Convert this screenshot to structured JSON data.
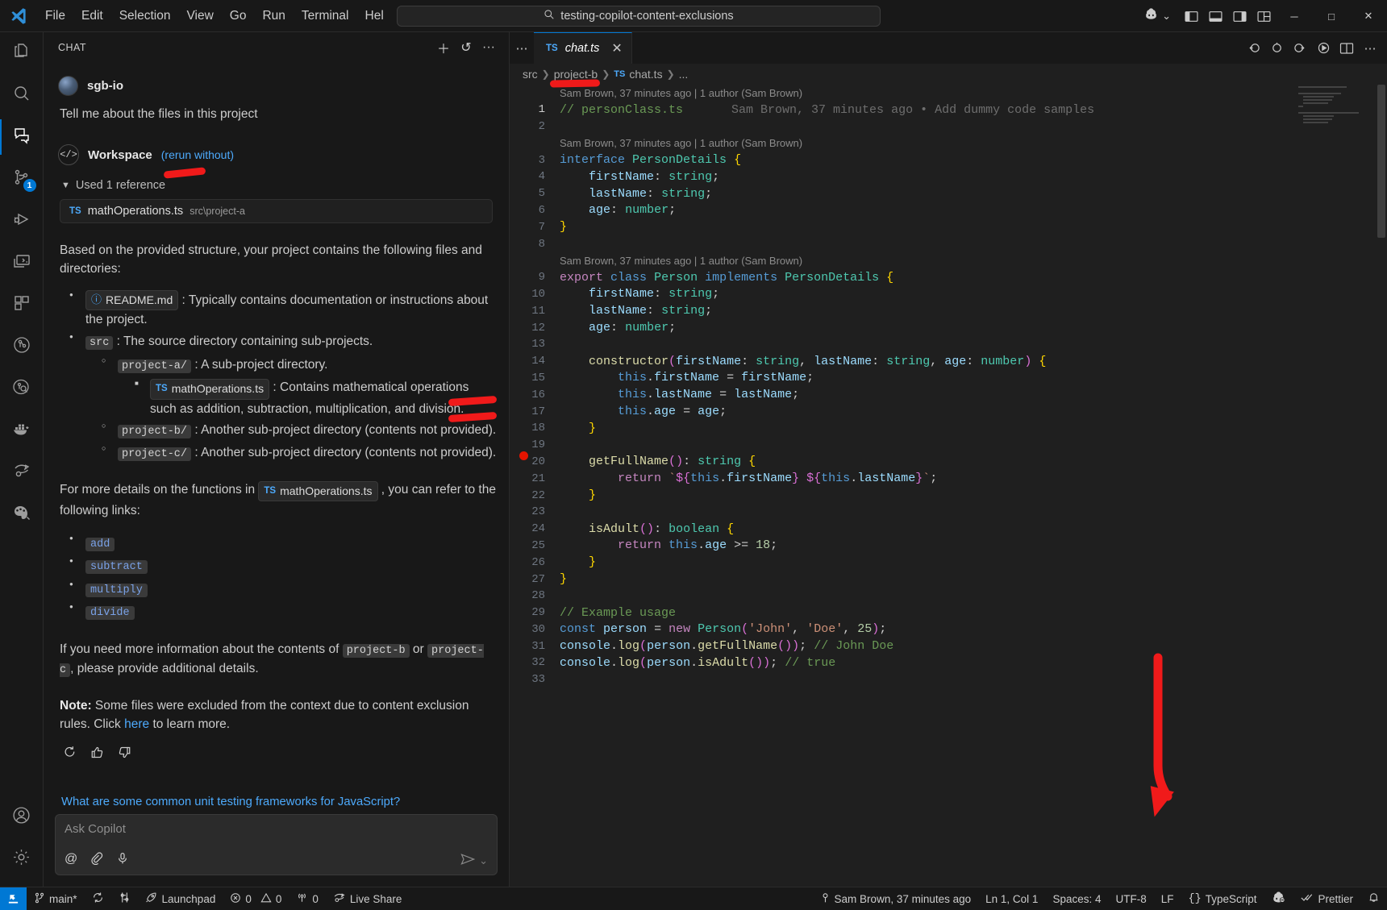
{
  "titlebar": {
    "menus": [
      "File",
      "Edit",
      "Selection",
      "View",
      "Go",
      "Run",
      "Terminal",
      "Hel"
    ],
    "back_icon": "←",
    "forward_icon": "→",
    "search_value": "testing-copilot-content-exclusions",
    "search_icon": "⌕",
    "copilot_icon": "copilot-icon",
    "chevron": "⌄",
    "layout_icons": [
      "panel-left-icon",
      "panel-bottom-icon",
      "panel-right-icon",
      "layout-grid-icon"
    ],
    "minimize": "─",
    "maximize": "□",
    "close": "✕"
  },
  "activitybar": {
    "items": [
      {
        "name": "explorer",
        "icon": "files-icon",
        "badge": ""
      },
      {
        "name": "search",
        "icon": "search-icon",
        "badge": ""
      },
      {
        "name": "chat",
        "icon": "chat-icon",
        "badge": ""
      },
      {
        "name": "source-control",
        "icon": "source-control-icon",
        "badge": "1"
      },
      {
        "name": "run-and-debug",
        "icon": "debug-icon",
        "badge": ""
      },
      {
        "name": "remote-explorer",
        "icon": "remote-icon",
        "badge": ""
      },
      {
        "name": "extensions",
        "icon": "extensions-icon",
        "badge": ""
      },
      {
        "name": "test-explorer",
        "icon": "beaker-icon",
        "badge": ""
      },
      {
        "name": "github-actions",
        "icon": "github-actions-icon",
        "badge": ""
      },
      {
        "name": "docker",
        "icon": "docker-icon",
        "badge": ""
      },
      {
        "name": "live-share",
        "icon": "live-share-icon",
        "badge": ""
      },
      {
        "name": "theme-palette",
        "icon": "palette-icon",
        "badge": ""
      }
    ],
    "bottom": [
      {
        "name": "accounts",
        "icon": "account-icon"
      },
      {
        "name": "settings",
        "icon": "gear-icon"
      }
    ]
  },
  "chat": {
    "title": "CHAT",
    "actions": [
      {
        "name": "new-chat",
        "icon": "＋"
      },
      {
        "name": "chat-history",
        "icon": "↺"
      },
      {
        "name": "more-actions",
        "icon": "···"
      }
    ],
    "user": "sgb-io",
    "user_message": "Tell me about the files in this project",
    "agent": {
      "name": "Workspace",
      "rerun_label": "(rerun without)",
      "icon": "</>"
    },
    "references": {
      "label": "Used 1 reference",
      "items": [
        {
          "type": "TS",
          "file": "mathOperations.ts",
          "path": "src\\project-a"
        }
      ]
    },
    "response": {
      "intro": "Based on the provided structure, your project contains the following files and directories:",
      "tree": [
        {
          "chip": "README.md",
          "chip_icon": "info-icon",
          "chip_style": "ic",
          "text": " : Typically contains documentation or instructions about the project.",
          "children": []
        },
        {
          "chip": "src",
          "chip_style": "mono",
          "text": " : The source directory containing sub-projects.",
          "children": [
            {
              "chip": "project-a/",
              "chip_style": "mono",
              "text": " : A sub-project directory.",
              "children": [
                {
                  "chip": "mathOperations.ts",
                  "chip_icon": "TS",
                  "chip_style": "ic",
                  "text": " : Contains mathematical operations such as addition, subtraction, multiplication, and division."
                }
              ]
            },
            {
              "chip": "project-b/",
              "chip_style": "mono",
              "text": " : Another sub-project directory (contents not provided).",
              "children": []
            },
            {
              "chip": "project-c/",
              "chip_style": "mono",
              "text": " : Another sub-project directory (contents not provided).",
              "children": []
            }
          ]
        }
      ],
      "links_intro_a": "For more details on the functions in ",
      "links_intro_chip": "mathOperations.ts",
      "links_intro_b": " , you can refer to the following links:",
      "functions": [
        "add",
        "subtract",
        "multiply",
        "divide"
      ],
      "closing_a": "If you need more information about the contents of ",
      "closing_chip1": "project-b",
      "closing_mid": " or ",
      "closing_chip2": "project-c",
      "closing_b": ", please provide additional details.",
      "note_label": "Note:",
      "note_text": " Some files were excluded from the context due to content exclusion rules. Click ",
      "note_link": "here",
      "note_tail": " to learn more."
    },
    "feedback": [
      {
        "name": "regenerate",
        "icon": "↻"
      },
      {
        "name": "thumbs-up",
        "icon": "👍"
      },
      {
        "name": "thumbs-down",
        "icon": "👎"
      }
    ],
    "suggestion": "What are some common unit testing frameworks for JavaScript?",
    "input_placeholder": "Ask Copilot",
    "input_icons": [
      {
        "name": "mention",
        "icon": "@"
      },
      {
        "name": "attach",
        "icon": "📎"
      },
      {
        "name": "microphone",
        "icon": "🎙"
      }
    ],
    "send_icon": "➤",
    "send_chevron": "⌄"
  },
  "editor": {
    "tab": {
      "type": "TS",
      "name": "chat.ts",
      "close": "✕"
    },
    "actions": [
      {
        "name": "go-back",
        "icon": "↩"
      },
      {
        "name": "run-tests",
        "icon": "○"
      },
      {
        "name": "go-forward",
        "icon": "↪"
      },
      {
        "name": "run-debug",
        "icon": "▷"
      },
      {
        "name": "split-editor",
        "icon": "◫"
      },
      {
        "name": "more-actions",
        "icon": "···"
      }
    ],
    "breadcrumbs": [
      {
        "label": "src",
        "icon": ""
      },
      {
        "label": "project-b",
        "icon": ""
      },
      {
        "label": "chat.ts",
        "icon": "TS"
      },
      {
        "label": "...",
        "icon": ""
      }
    ],
    "blame_text": "Sam Brown, 37 minutes ago | 1 author (Sam Brown)",
    "inline_blame": "Sam Brown, 37 minutes ago • Add dummy code samples",
    "lines": [
      {
        "n": "1",
        "blame": true,
        "text": "// personClass.ts"
      },
      {
        "n": "2",
        "blame": false,
        "text": ""
      },
      {
        "n": "3",
        "blame": true,
        "text": "interface PersonDetails {"
      },
      {
        "n": "4",
        "blame": false,
        "text": "    firstName: string;"
      },
      {
        "n": "5",
        "blame": false,
        "text": "    lastName: string;"
      },
      {
        "n": "6",
        "blame": false,
        "text": "    age: number;"
      },
      {
        "n": "7",
        "blame": false,
        "text": "}"
      },
      {
        "n": "8",
        "blame": false,
        "text": ""
      },
      {
        "n": "9",
        "blame": true,
        "text": "export class Person implements PersonDetails {"
      },
      {
        "n": "10",
        "blame": false,
        "text": "    firstName: string;"
      },
      {
        "n": "11",
        "blame": false,
        "text": "    lastName: string;"
      },
      {
        "n": "12",
        "blame": false,
        "text": "    age: number;"
      },
      {
        "n": "13",
        "blame": false,
        "text": ""
      },
      {
        "n": "14",
        "blame": false,
        "text": "    constructor(firstName: string, lastName: string, age: number) {"
      },
      {
        "n": "15",
        "blame": false,
        "text": "        this.firstName = firstName;"
      },
      {
        "n": "16",
        "blame": false,
        "text": "        this.lastName = lastName;"
      },
      {
        "n": "17",
        "blame": false,
        "text": "        this.age = age;"
      },
      {
        "n": "18",
        "blame": false,
        "text": "    }"
      },
      {
        "n": "19",
        "blame": false,
        "text": ""
      },
      {
        "n": "20",
        "blame": false,
        "text": "    getFullName(): string {"
      },
      {
        "n": "21",
        "blame": false,
        "text": "        return `${this.firstName} ${this.lastName}`;"
      },
      {
        "n": "22",
        "blame": false,
        "text": "    }"
      },
      {
        "n": "23",
        "blame": false,
        "text": ""
      },
      {
        "n": "24",
        "blame": false,
        "text": "    isAdult(): boolean {"
      },
      {
        "n": "25",
        "blame": false,
        "text": "        return this.age >= 18;"
      },
      {
        "n": "26",
        "blame": false,
        "text": "    }"
      },
      {
        "n": "27",
        "blame": false,
        "text": "}"
      },
      {
        "n": "28",
        "blame": false,
        "text": ""
      },
      {
        "n": "29",
        "blame": false,
        "text": "// Example usage"
      },
      {
        "n": "30",
        "blame": false,
        "text": "const person = new Person('John', 'Doe', 25);"
      },
      {
        "n": "31",
        "blame": false,
        "text": "console.log(person.getFullName()); // John Doe"
      },
      {
        "n": "32",
        "blame": false,
        "text": "console.log(person.isAdult()); // true"
      },
      {
        "n": "33",
        "blame": false,
        "text": ""
      }
    ]
  },
  "statusbar": {
    "remote_icon": "⤨",
    "left": [
      {
        "name": "branch",
        "icon": "⎇",
        "label": "main*"
      },
      {
        "name": "sync",
        "icon": "↻",
        "label": ""
      },
      {
        "name": "graph",
        "icon": "⛓",
        "label": ""
      },
      {
        "name": "launchpad",
        "icon": "🚀",
        "label": "Launchpad"
      },
      {
        "name": "problems",
        "icon": "⊗",
        "label": "0"
      },
      {
        "name": "warnings",
        "icon": "⚠",
        "label": "0"
      },
      {
        "name": "ports",
        "icon": "⚙",
        "label": "0"
      },
      {
        "name": "live-share",
        "icon": "↪",
        "label": "Live Share"
      }
    ],
    "right": [
      {
        "name": "git-blame",
        "icon": "⚲",
        "label": "Sam Brown, 37 minutes ago"
      },
      {
        "name": "cursor-position",
        "icon": "",
        "label": "Ln 1, Col 1"
      },
      {
        "name": "indentation",
        "icon": "",
        "label": "Spaces: 4"
      },
      {
        "name": "encoding",
        "icon": "",
        "label": "UTF-8"
      },
      {
        "name": "eol",
        "icon": "",
        "label": "LF"
      },
      {
        "name": "language-mode",
        "icon": "{}",
        "label": "TypeScript"
      },
      {
        "name": "copilot-status",
        "icon": "copilot-disabled-icon",
        "label": ""
      },
      {
        "name": "prettier",
        "icon": "✓✓",
        "label": "Prettier"
      },
      {
        "name": "notifications",
        "icon": "🔔",
        "label": ""
      }
    ]
  },
  "annotations": {
    "color": "#f01a1a",
    "marks": [
      {
        "name": "highlight-used-reference"
      },
      {
        "name": "highlight-project-b-breadcrumb"
      },
      {
        "name": "highlight-project-b-line"
      },
      {
        "name": "highlight-project-c-line"
      },
      {
        "name": "arrow-to-copilot-status"
      }
    ]
  }
}
